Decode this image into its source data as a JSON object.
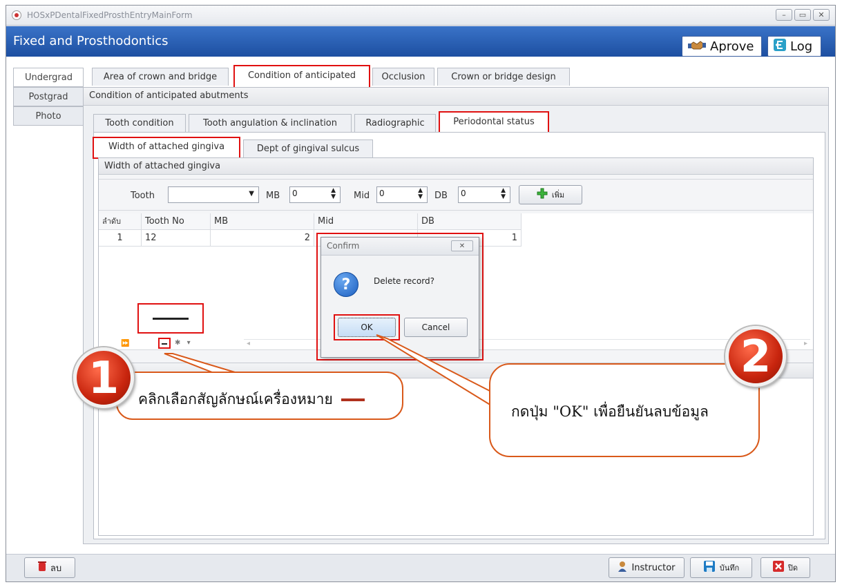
{
  "window": {
    "title": "HOSxPDentalFixedProsthEntryMainForm",
    "controls": [
      "–",
      "▭",
      "✕"
    ]
  },
  "header": {
    "title": "Fixed and Prosthodontics",
    "approve_label": "Aprove",
    "log_label": "Log"
  },
  "side_tabs": [
    "Undergrad",
    "Postgrad",
    "Photo"
  ],
  "top_tabs": [
    "Area of crown and bridge",
    "Condition of anticipated",
    "Occlusion",
    "Crown or bridge design"
  ],
  "section_title": "Condition of anticipated abutments",
  "sub_tabs": [
    "Tooth condition",
    "Tooth angulation & inclination",
    "Radiographic",
    "Periodontal status"
  ],
  "inner_tabs": [
    "Width of attached gingiva",
    "Dept of gingival sulcus"
  ],
  "group": {
    "title": "Width of attached gingiva"
  },
  "form": {
    "tooth_label": "Tooth",
    "tooth_value": "",
    "mb_label": "MB",
    "mb_value": "0",
    "mid_label": "Mid",
    "mid_value": "0",
    "db_label": "DB",
    "db_value": "0",
    "add_button": "เพิ่ม"
  },
  "table": {
    "columns": [
      "ลำดับ",
      "Tooth No",
      "MB",
      "Mid",
      "DB"
    ],
    "rows": [
      {
        "seq": "1",
        "tooth_no": "12",
        "mb": "2",
        "mid": "",
        "db": "1"
      }
    ]
  },
  "dialog": {
    "title": "Confirm",
    "message": "Delete record?",
    "ok": "OK",
    "cancel": "Cancel"
  },
  "callouts": {
    "step1_number": "1",
    "step1_text": "คลิกเลือกสัญลักษณ์เครื่องหมาย",
    "step2_number": "2",
    "step2_text": "กดปุ่ม \"OK\" เพื่อยืนยันลบข้อมูล"
  },
  "footer": {
    "delete_label": "ลบ",
    "instructor_label": "Instructor",
    "save_label": "บันทึก",
    "close_label": "ปิด"
  },
  "colors": {
    "header_blue": "#1d4fa1",
    "highlight_red": "#e01010",
    "callout_orange": "#d9591a"
  },
  "icons": {
    "approve": "handshake-icon",
    "log": "log-arrow-icon",
    "add": "plus-icon",
    "question": "question-icon",
    "delete": "trash-icon",
    "instructor": "user-icon",
    "save": "save-icon",
    "close": "close-icon"
  }
}
